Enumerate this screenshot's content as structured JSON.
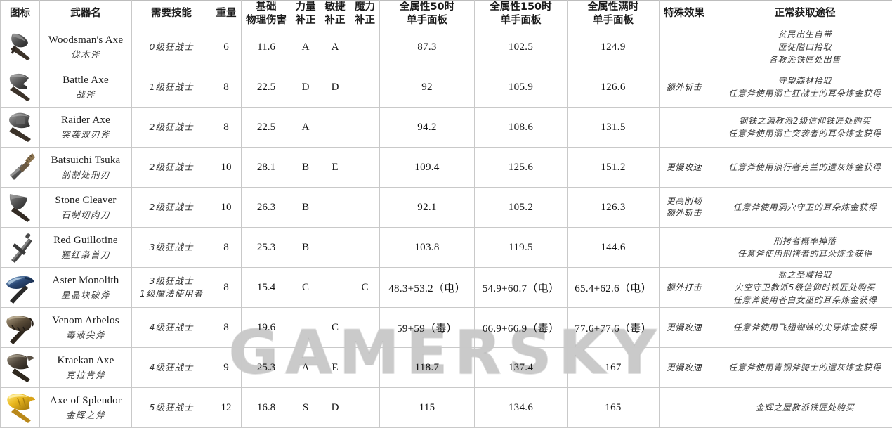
{
  "watermark": "GAMERSKY",
  "table": {
    "headers": [
      {
        "key": "icon",
        "lines": [
          "图标"
        ]
      },
      {
        "key": "name",
        "lines": [
          "武器名"
        ]
      },
      {
        "key": "skill",
        "lines": [
          "需要技能"
        ]
      },
      {
        "key": "weight",
        "lines": [
          "重量"
        ]
      },
      {
        "key": "damage",
        "lines": [
          "基础",
          "物理伤害"
        ]
      },
      {
        "key": "str",
        "lines": [
          "力量",
          "补正"
        ]
      },
      {
        "key": "dex",
        "lines": [
          "敏捷",
          "补正"
        ]
      },
      {
        "key": "mag",
        "lines": [
          "魔力",
          "补正"
        ]
      },
      {
        "key": "panel50",
        "lines": [
          "全属性50时",
          "单手面板"
        ]
      },
      {
        "key": "panel150",
        "lines": [
          "全属性150时",
          "单手面板"
        ]
      },
      {
        "key": "panelmax",
        "lines": [
          "全属性满时",
          "单手面板"
        ]
      },
      {
        "key": "effect",
        "lines": [
          "特殊效果"
        ]
      },
      {
        "key": "acquire",
        "lines": [
          "正常获取途径"
        ]
      }
    ],
    "rows": [
      {
        "icon": "woodsmans-axe-icon",
        "name_en": "Woodsman's Axe",
        "name_cn": "伐木斧",
        "skill": [
          "0级狂战士"
        ],
        "weight": "6",
        "damage": "11.6",
        "str": "A",
        "dex": "A",
        "mag": "",
        "panel50": "87.3",
        "panel150": "102.5",
        "panelmax": "124.9",
        "effect": [],
        "acquire": [
          "贫民出生自带",
          "匪徒隘口拾取",
          "各教派铁匠处出售"
        ]
      },
      {
        "icon": "battle-axe-icon",
        "name_en": "Battle Axe",
        "name_cn": "战斧",
        "skill": [
          "1级狂战士"
        ],
        "weight": "8",
        "damage": "22.5",
        "str": "D",
        "dex": "D",
        "mag": "",
        "panel50": "92",
        "panel150": "105.9",
        "panelmax": "126.6",
        "effect": [
          "额外斩击"
        ],
        "acquire": [
          "守望森林拾取",
          "任意斧使用溺亡狂战士的耳朵炼金获得"
        ]
      },
      {
        "icon": "raider-axe-icon",
        "name_en": "Raider Axe",
        "name_cn": "突袭双刃斧",
        "skill": [
          "2级狂战士"
        ],
        "weight": "8",
        "damage": "22.5",
        "str": "A",
        "dex": "",
        "mag": "",
        "panel50": "94.2",
        "panel150": "108.6",
        "panelmax": "131.5",
        "effect": [],
        "acquire": [
          "钢铁之源教派2级信仰铁匠处购买",
          "任意斧使用溺亡突袭者的耳朵炼金获得"
        ]
      },
      {
        "icon": "batsuichi-tsuka-icon",
        "name_en": "Batsuichi Tsuka",
        "name_cn": "剖割处刑刃",
        "skill": [
          "2级狂战士"
        ],
        "weight": "10",
        "damage": "28.1",
        "str": "B",
        "dex": "E",
        "mag": "",
        "panel50": "109.4",
        "panel150": "125.6",
        "panelmax": "151.2",
        "effect": [
          "更慢攻速"
        ],
        "acquire": [
          "任意斧使用浪行者克兰的遗灰炼金获得"
        ]
      },
      {
        "icon": "stone-cleaver-icon",
        "name_en": "Stone Cleaver",
        "name_cn": "石制切肉刀",
        "skill": [
          "2级狂战士"
        ],
        "weight": "10",
        "damage": "26.3",
        "str": "B",
        "dex": "",
        "mag": "",
        "panel50": "92.1",
        "panel150": "105.2",
        "panelmax": "126.3",
        "effect": [
          "更高削韧",
          "额外斩击"
        ],
        "acquire": [
          "任意斧使用洞穴守卫的耳朵炼金获得"
        ]
      },
      {
        "icon": "red-guillotine-icon",
        "name_en": "Red Guillotine",
        "name_cn": "猩红枭首刀",
        "skill": [
          "3级狂战士"
        ],
        "weight": "8",
        "damage": "25.3",
        "str": "B",
        "dex": "",
        "mag": "",
        "panel50": "103.8",
        "panel150": "119.5",
        "panelmax": "144.6",
        "effect": [],
        "acquire": [
          "刑拷者概率掉落",
          "任意斧使用刑拷者的耳朵炼金获得"
        ]
      },
      {
        "icon": "aster-monolith-icon",
        "name_en": "Aster Monolith",
        "name_cn": "星晶块破斧",
        "skill": [
          "3级狂战士",
          "1级魔法使用者"
        ],
        "weight": "8",
        "damage": "15.4",
        "str": "C",
        "dex": "",
        "mag": "C",
        "panel50": "48.3+53.2（电）",
        "panel150": "54.9+60.7（电）",
        "panelmax": "65.4+62.6（电）",
        "effect": [
          "额外打击"
        ],
        "acquire": [
          "盐之圣域拾取",
          "火空守卫教派5级信仰时铁匠处购买",
          "任意斧使用苍白女巫的耳朵炼金获得"
        ]
      },
      {
        "icon": "venom-arbelos-icon",
        "name_en": "Venom Arbelos",
        "name_cn": "毒液尖斧",
        "skill": [
          "4级狂战士"
        ],
        "weight": "8",
        "damage": "19.6",
        "str": "",
        "dex": "C",
        "mag": "",
        "panel50": "59+59（毒）",
        "panel150": "66.9+66.9（毒）",
        "panelmax": "77.6+77.6（毒）",
        "effect": [
          "更慢攻速"
        ],
        "acquire": [
          "任意斧使用飞翅蜘蛛的尖牙炼金获得"
        ]
      },
      {
        "icon": "kraekan-axe-icon",
        "name_en": "Kraekan Axe",
        "name_cn": "克拉肯斧",
        "skill": [
          "4级狂战士"
        ],
        "weight": "9",
        "damage": "25.3",
        "str": "A",
        "dex": "E",
        "mag": "",
        "panel50": "118.7",
        "panel150": "137.4",
        "panelmax": "167",
        "effect": [
          "更慢攻速"
        ],
        "acquire": [
          "任意斧使用青铜斧骑士的遗灰炼金获得"
        ]
      },
      {
        "icon": "axe-of-splendor-icon",
        "name_en": "Axe of Splendor",
        "name_cn": "金辉之斧",
        "skill": [
          "5级狂战士"
        ],
        "weight": "12",
        "damage": "16.8",
        "str": "S",
        "dex": "D",
        "mag": "",
        "panel50": "115",
        "panel150": "134.6",
        "panelmax": "165",
        "effect": [],
        "acquire": [
          "金辉之屋教派铁匠处购买"
        ]
      }
    ]
  }
}
